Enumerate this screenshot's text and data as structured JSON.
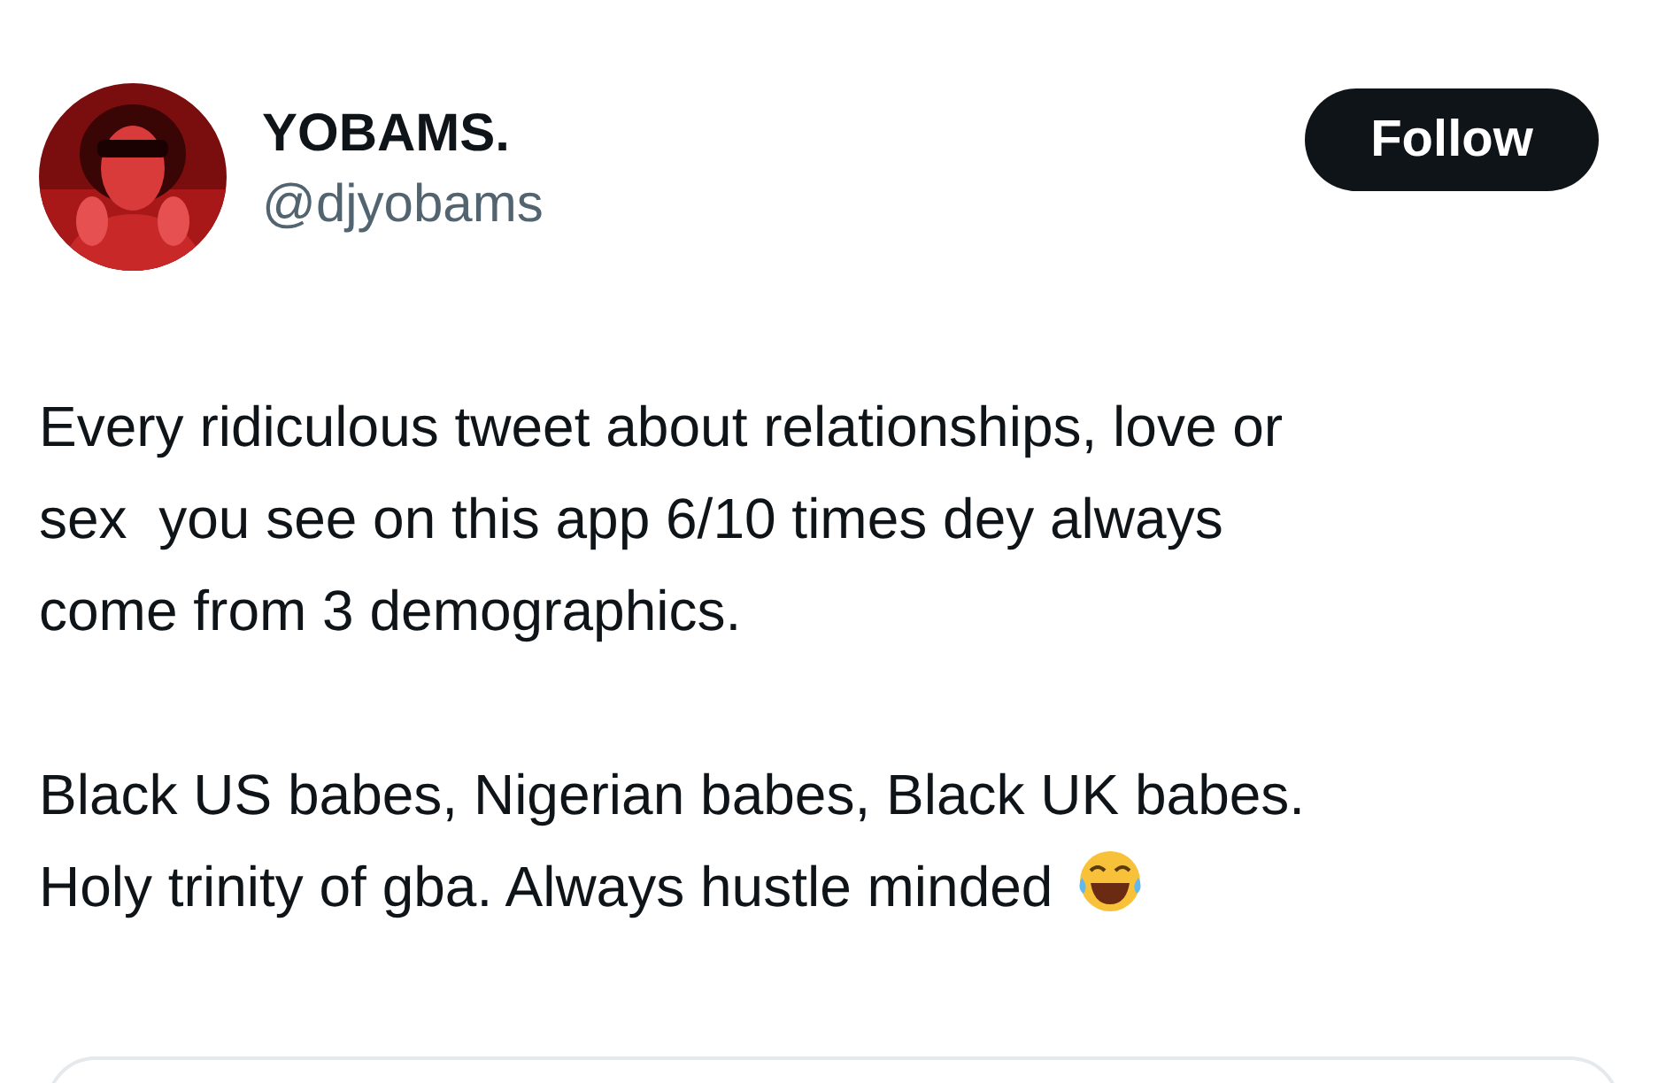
{
  "author": {
    "name": "YOBAMS.",
    "handle": "@djyobams"
  },
  "follow_button": {
    "label": "Follow"
  },
  "tweet": {
    "paragraphs": [
      {
        "sentences": [
          {
            "text": "Every ridiculous tweet about relationships, love or\nsex  you see on this app 6/10 times dey always\ncome from 3 demographics.",
            "emoji": false
          }
        ]
      },
      {
        "sentences": [
          {
            "text": "Black US babes, Nigerian babes, Black UK babes.",
            "emoji": false
          },
          {
            "text": "Holy trinity of gba. Always hustle minded",
            "emoji": true
          }
        ]
      }
    ]
  }
}
